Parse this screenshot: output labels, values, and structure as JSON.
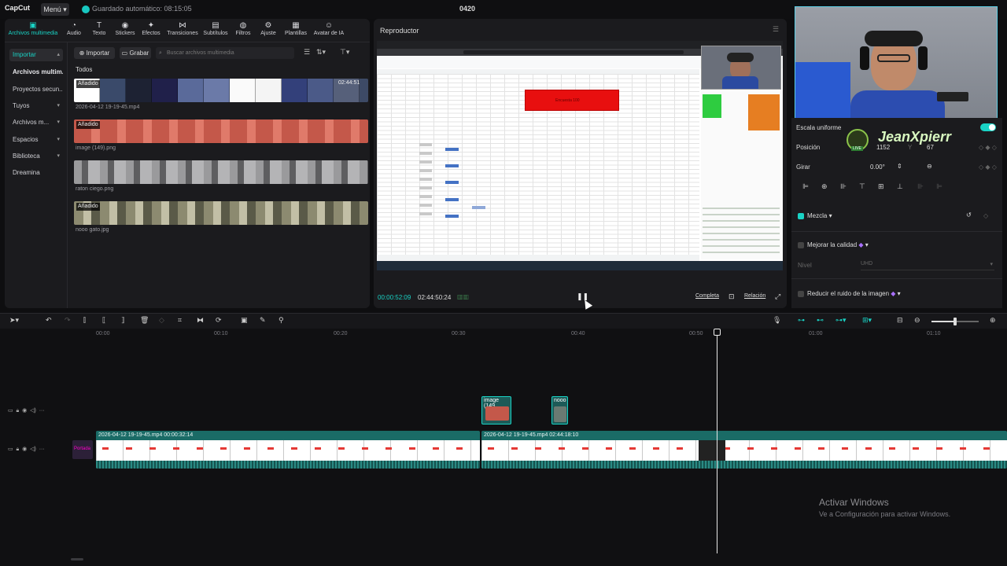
{
  "titlebar": {
    "app_logo": "CapCut",
    "menu": "Menú",
    "autosave": "Guardado automático: 08:15:05",
    "project_title": "0420"
  },
  "toolbar": {
    "items": [
      {
        "label": "Archivos multimedia",
        "icon": "media-icon"
      },
      {
        "label": "Audio",
        "icon": "audio-icon"
      },
      {
        "label": "Texto",
        "icon": "text-icon"
      },
      {
        "label": "Stickers",
        "icon": "sticker-icon"
      },
      {
        "label": "Efectos",
        "icon": "effects-icon"
      },
      {
        "label": "Transiciones",
        "icon": "transitions-icon"
      },
      {
        "label": "Subtítulos",
        "icon": "captions-icon"
      },
      {
        "label": "Filtros",
        "icon": "filters-icon"
      },
      {
        "label": "Ajuste",
        "icon": "adjust-icon"
      },
      {
        "label": "Plantillas",
        "icon": "templates-icon"
      },
      {
        "label": "Avatar de IA",
        "icon": "ai-avatar-icon"
      }
    ]
  },
  "sidebar": {
    "items": [
      {
        "label": "Importar"
      },
      {
        "label": "Archivos multim..."
      },
      {
        "label": "Proyectos secun..."
      },
      {
        "label": "Tuyos"
      },
      {
        "label": "Archivos m..."
      },
      {
        "label": "Espacios"
      },
      {
        "label": "Biblioteca"
      },
      {
        "label": "Dreamina"
      }
    ]
  },
  "media": {
    "import_label": "Importar",
    "record_label": "Grabar",
    "search_placeholder": "Buscar archivos multimedia",
    "all_label": "Todos",
    "items": [
      {
        "name": "2026-04-12 19-19-45.mp4",
        "badge": "Añadido",
        "duration": "02:44:51"
      },
      {
        "name": "image (149).png",
        "badge": "Añadido"
      },
      {
        "name": "raton ciego.png"
      },
      {
        "name": "nooo gato.jpg",
        "badge": "Añadido"
      }
    ]
  },
  "player": {
    "title": "Reproductor",
    "current_time": "00:00:52:09",
    "total_time": "02:44:50:24",
    "full_label": "Completa",
    "ratio_label": "Relación",
    "screen": {
      "red_cell_text": "Encuesta 100"
    }
  },
  "stream": {
    "name": "JeanXpierr",
    "live_badge": "LIVE"
  },
  "properties": {
    "uniform_scale": "Escala uniforme",
    "position_label": "Posición",
    "position_x": "1152",
    "position_y_label": "Y",
    "position_y": "67",
    "rotate_label": "Girar",
    "rotate_value": "0.00°",
    "blend_label": "Mezcla",
    "quality_label": "Mejorar la calidad",
    "level_label": "Nivel",
    "level_value": "UHD",
    "noise_label": "Reducir el ruido de la imagen"
  },
  "timeline": {
    "ruler": [
      "00:00",
      "00:10",
      "00:20",
      "00:30",
      "00:40",
      "00:50",
      "01:00",
      "01:10"
    ],
    "overlay_clips": [
      {
        "label": "image (149"
      },
      {
        "label": "nooo"
      }
    ],
    "main_clips": [
      {
        "caption": "2026-04-12 19-19-45.mp4   00:00:32:14"
      },
      {
        "caption": "2026-04-12 19-19-45.mp4   02:44:18:10"
      }
    ],
    "cover_label": "Portada"
  },
  "windows_notice": {
    "title": "Activar Windows",
    "subtitle": "Ve a Configuración para activar Windows."
  },
  "colors": {
    "accent": "#19d3c5",
    "panel": "#1b1b1e",
    "background": "#0e0e10",
    "sheet_red": "#e80f0f"
  }
}
